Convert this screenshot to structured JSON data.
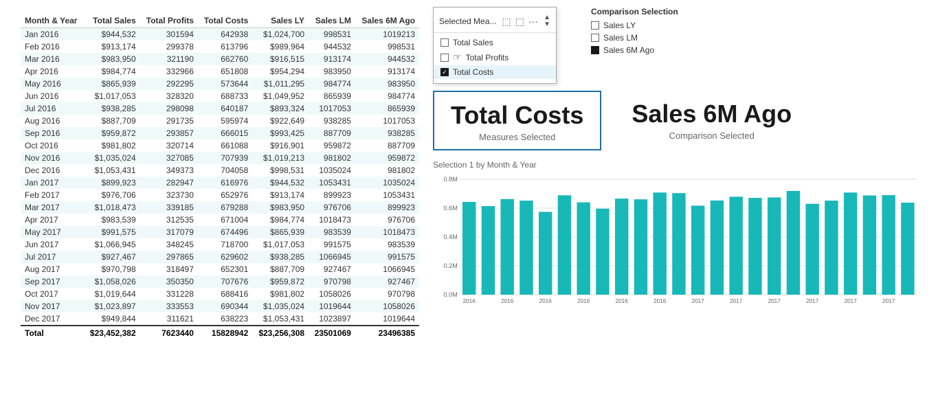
{
  "table": {
    "headers": [
      "Month & Year",
      "Total Sales",
      "Total Profits",
      "Total Costs",
      "Sales LY",
      "Sales LM",
      "Sales 6M Ago"
    ],
    "rows": [
      [
        "Jan 2016",
        "$944,532",
        "301594",
        "642938",
        "$1,024,700",
        "998531",
        "1019213"
      ],
      [
        "Feb 2016",
        "$913,174",
        "299378",
        "613796",
        "$989,964",
        "944532",
        "998531"
      ],
      [
        "Mar 2016",
        "$983,950",
        "321190",
        "662760",
        "$916,515",
        "913174",
        "944532"
      ],
      [
        "Apr 2016",
        "$984,774",
        "332966",
        "651808",
        "$954,294",
        "983950",
        "913174"
      ],
      [
        "May 2016",
        "$865,939",
        "292295",
        "573644",
        "$1,011,295",
        "984774",
        "983950"
      ],
      [
        "Jun 2016",
        "$1,017,053",
        "328320",
        "688733",
        "$1,049,952",
        "865939",
        "984774"
      ],
      [
        "Jul 2016",
        "$938,285",
        "298098",
        "640187",
        "$893,324",
        "1017053",
        "865939"
      ],
      [
        "Aug 2016",
        "$887,709",
        "291735",
        "595974",
        "$922,649",
        "938285",
        "1017053"
      ],
      [
        "Sep 2016",
        "$959,872",
        "293857",
        "666015",
        "$993,425",
        "887709",
        "938285"
      ],
      [
        "Oct 2016",
        "$981,802",
        "320714",
        "661088",
        "$916,901",
        "959872",
        "887709"
      ],
      [
        "Nov 2016",
        "$1,035,024",
        "327085",
        "707939",
        "$1,019,213",
        "981802",
        "959872"
      ],
      [
        "Dec 2016",
        "$1,053,431",
        "349373",
        "704058",
        "$998,531",
        "1035024",
        "981802"
      ],
      [
        "Jan 2017",
        "$899,923",
        "282947",
        "616976",
        "$944,532",
        "1053431",
        "1035024"
      ],
      [
        "Feb 2017",
        "$976,706",
        "323730",
        "652976",
        "$913,174",
        "899923",
        "1053431"
      ],
      [
        "Mar 2017",
        "$1,018,473",
        "339185",
        "679288",
        "$983,950",
        "976706",
        "899923"
      ],
      [
        "Apr 2017",
        "$983,539",
        "312535",
        "671004",
        "$984,774",
        "1018473",
        "976706"
      ],
      [
        "May 2017",
        "$991,575",
        "317079",
        "674496",
        "$865,939",
        "983539",
        "1018473"
      ],
      [
        "Jun 2017",
        "$1,066,945",
        "348245",
        "718700",
        "$1,017,053",
        "991575",
        "983539"
      ],
      [
        "Jul 2017",
        "$927,467",
        "297865",
        "629602",
        "$938,285",
        "1066945",
        "991575"
      ],
      [
        "Aug 2017",
        "$970,798",
        "318497",
        "652301",
        "$887,709",
        "927467",
        "1066945"
      ],
      [
        "Sep 2017",
        "$1,058,026",
        "350350",
        "707676",
        "$959,872",
        "970798",
        "927467"
      ],
      [
        "Oct 2017",
        "$1,019,644",
        "331228",
        "688416",
        "$981,802",
        "1058026",
        "970798"
      ],
      [
        "Nov 2017",
        "$1,023,897",
        "333553",
        "690344",
        "$1,035,024",
        "1019644",
        "1058026"
      ],
      [
        "Dec 2017",
        "$949,844",
        "311621",
        "638223",
        "$1,053,431",
        "1023897",
        "1019644"
      ]
    ],
    "footer": [
      "Total",
      "$23,452,382",
      "7623440",
      "15828942",
      "$23,256,308",
      "23501069",
      "23496385"
    ]
  },
  "dropdown": {
    "title": "Selected Mea...",
    "items": [
      {
        "label": "Total Sales",
        "checked": false
      },
      {
        "label": "Total Profits",
        "checked": false
      },
      {
        "label": "Total Costs",
        "checked": true
      }
    ]
  },
  "comparison": {
    "title": "Comparison Selection",
    "items": [
      {
        "label": "Sales LY",
        "checked": false
      },
      {
        "label": "Sales LM",
        "checked": false
      },
      {
        "label": "Sales 6M Ago",
        "checked": true
      }
    ]
  },
  "kpi": {
    "primary": {
      "value": "Total Costs",
      "label": "Measures Selected"
    },
    "secondary": {
      "value": "Sales 6M Ago",
      "label": "Comparison Selected"
    }
  },
  "chart": {
    "title": "Selection 1 by Month & Year",
    "y_labels": [
      "0.0M",
      "0.2M",
      "0.4M",
      "0.6M",
      "0.8M"
    ],
    "bars": [
      {
        "label": "2016",
        "value": 0.643
      },
      {
        "label": "2016",
        "value": 0.614
      },
      {
        "label": "2016",
        "value": 0.663
      },
      {
        "label": "2016",
        "value": 0.652
      },
      {
        "label": "2016",
        "value": 0.574
      },
      {
        "label": "2016",
        "value": 0.689
      },
      {
        "label": "2016",
        "value": 0.64
      },
      {
        "label": "2016",
        "value": 0.596
      },
      {
        "label": "2016",
        "value": 0.666
      },
      {
        "label": "2016",
        "value": 0.661
      },
      {
        "label": "2016",
        "value": 0.708
      },
      {
        "label": "2016",
        "value": 0.704
      },
      {
        "label": "2017",
        "value": 0.617
      },
      {
        "label": "2017",
        "value": 0.653
      },
      {
        "label": "2017",
        "value": 0.679
      },
      {
        "label": "2017",
        "value": 0.671
      },
      {
        "label": "2017",
        "value": 0.674
      },
      {
        "label": "2017",
        "value": 0.719
      },
      {
        "label": "2017",
        "value": 0.63
      },
      {
        "label": "2017",
        "value": 0.652
      },
      {
        "label": "2017",
        "value": 0.708
      },
      {
        "label": "2017",
        "value": 0.688
      },
      {
        "label": "2017",
        "value": 0.69
      },
      {
        "label": "2017",
        "value": 0.638
      }
    ],
    "bar_color": "#18b8b8",
    "max_value": 0.8
  }
}
